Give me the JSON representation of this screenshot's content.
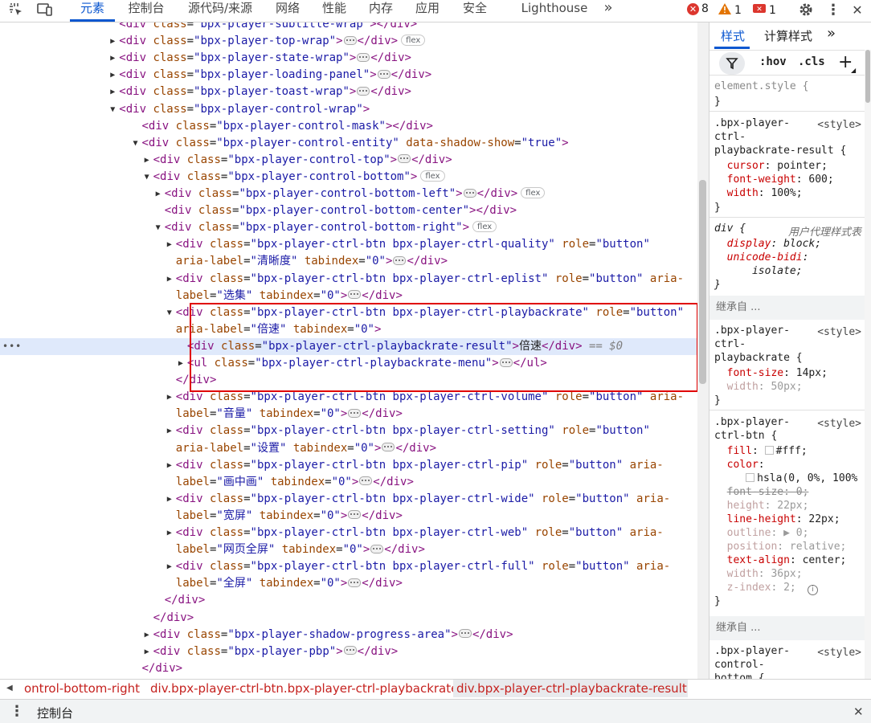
{
  "toolbar": {
    "tabs": [
      "元素",
      "控制台",
      "源代码/来源",
      "网络",
      "性能",
      "内存",
      "应用",
      "安全",
      "Lighthouse"
    ],
    "overflow_glyph": "»",
    "errors": "8",
    "warnings": "1",
    "issues": "1"
  },
  "dom_lines": [
    {
      "indent": 13,
      "tri": "",
      "html": "<span class='tg'>&lt;div</span> <span class='an'>class</span>=<span class='av'>\"bpx-player-subtitle-wrap\"</span><span class='tg'>&gt;&lt;/div&gt;</span>"
    },
    {
      "indent": 13,
      "tri": "▶",
      "html": "<span class='tg'>&lt;div</span> <span class='an'>class</span>=<span class='av'>\"bpx-player-top-wrap\"</span><span class='tg'>&gt;</span><span class='ell'></span><span class='tg'>&lt;/div&gt;</span><span class='flex'>flex</span>"
    },
    {
      "indent": 13,
      "tri": "▶",
      "html": "<span class='tg'>&lt;div</span> <span class='an'>class</span>=<span class='av'>\"bpx-player-state-wrap\"</span><span class='tg'>&gt;</span><span class='ell'></span><span class='tg'>&lt;/div&gt;</span>"
    },
    {
      "indent": 13,
      "tri": "▶",
      "html": "<span class='tg'>&lt;div</span> <span class='an'>class</span>=<span class='av'>\"bpx-player-loading-panel\"</span><span class='tg'>&gt;</span><span class='ell'></span><span class='tg'>&lt;/div&gt;</span>"
    },
    {
      "indent": 13,
      "tri": "▶",
      "html": "<span class='tg'>&lt;div</span> <span class='an'>class</span>=<span class='av'>\"bpx-player-toast-wrap\"</span><span class='tg'>&gt;</span><span class='ell'></span><span class='tg'>&lt;/div&gt;</span>"
    },
    {
      "indent": 13,
      "tri": "▼",
      "html": "<span class='tg'>&lt;div</span> <span class='an'>class</span>=<span class='av'>\"bpx-player-control-wrap\"</span><span class='tg'>&gt;</span>"
    },
    {
      "indent": 15,
      "tri": "",
      "html": "<span class='tg'>&lt;div</span> <span class='an'>class</span>=<span class='av'>\"bpx-player-control-mask\"</span><span class='tg'>&gt;&lt;/div&gt;</span>"
    },
    {
      "indent": 15,
      "tri": "▼",
      "html": "<span class='tg'>&lt;div</span> <span class='an'>class</span>=<span class='av'>\"bpx-player-control-entity\"</span> <span class='an'>data-shadow-show</span>=<span class='av'>\"true\"</span><span class='tg'>&gt;</span>"
    },
    {
      "indent": 16,
      "tri": "▶",
      "html": "<span class='tg'>&lt;div</span> <span class='an'>class</span>=<span class='av'>\"bpx-player-control-top\"</span><span class='tg'>&gt;</span><span class='ell'></span><span class='tg'>&lt;/div&gt;</span>"
    },
    {
      "indent": 16,
      "tri": "▼",
      "html": "<span class='tg'>&lt;div</span> <span class='an'>class</span>=<span class='av'>\"bpx-player-control-bottom\"</span><span class='tg'>&gt;</span><span class='flex'>flex</span>"
    },
    {
      "indent": 17,
      "tri": "▶",
      "html": "<span class='tg'>&lt;div</span> <span class='an'>class</span>=<span class='av'>\"bpx-player-control-bottom-left\"</span><span class='tg'>&gt;</span><span class='ell'></span><span class='tg'>&lt;/div&gt;</span><span class='flex'>flex</span>"
    },
    {
      "indent": 17,
      "tri": "",
      "html": "<span class='tg'>&lt;div</span> <span class='an'>class</span>=<span class='av'>\"bpx-player-control-bottom-center\"</span><span class='tg'>&gt;&lt;/div&gt;</span>"
    },
    {
      "indent": 17,
      "tri": "▼",
      "html": "<span class='tg'>&lt;div</span> <span class='an'>class</span>=<span class='av'>\"bpx-player-control-bottom-right\"</span><span class='tg'>&gt;</span><span class='flex'>flex</span>"
    },
    {
      "indent": 18,
      "tri": "▶",
      "html": "<span class='tg'>&lt;div</span> <span class='an'>class</span>=<span class='av'>\"bpx-player-ctrl-btn bpx-player-ctrl-quality\"</span> <span class='an'>role</span>=<span class='av'>\"button\"</span>"
    },
    {
      "indent": 18,
      "tri": "",
      "html": "<span class='an'>aria-label</span>=<span class='av'>\"清晰度\"</span> <span class='an'>tabindex</span>=<span class='av'>\"0\"</span><span class='tg'>&gt;</span><span class='ell'></span><span class='tg'>&lt;/div&gt;</span>"
    },
    {
      "indent": 18,
      "tri": "▶",
      "html": "<span class='tg'>&lt;div</span> <span class='an'>class</span>=<span class='av'>\"bpx-player-ctrl-btn bpx-player-ctrl-eplist\"</span> <span class='an'>role</span>=<span class='av'>\"button\"</span> <span class='an'>aria-</span>"
    },
    {
      "indent": 18,
      "tri": "",
      "html": "<span class='an'>label</span>=<span class='av'>\"选集\"</span> <span class='an'>tabindex</span>=<span class='av'>\"0\"</span><span class='tg'>&gt;</span><span class='ell'></span><span class='tg'>&lt;/div&gt;</span>"
    },
    {
      "indent": 18,
      "tri": "▼",
      "html": "<span class='tg'>&lt;div</span> <span class='an'>class</span>=<span class='av'>\"bpx-player-ctrl-btn bpx-player-ctrl-playbackrate\"</span> <span class='an'>role</span>=<span class='av'>\"button\"</span>"
    },
    {
      "indent": 18,
      "tri": "",
      "html": "<span class='an'>aria-label</span>=<span class='av'>\"倍速\"</span> <span class='an'>tabindex</span>=<span class='av'>\"0\"</span><span class='tg'>&gt;</span>"
    },
    {
      "indent": 19,
      "tri": "",
      "hl": true,
      "html": "<span class='tg'>&lt;div</span> <span class='an'>class</span>=<span class='av'>\"bpx-player-ctrl-playbackrate-result\"</span><span class='tg'>&gt;</span><span class='tx'>倍速</span><span class='tg'>&lt;/div&gt;</span> <span class='dim'>== $0</span>"
    },
    {
      "indent": 19,
      "tri": "▶",
      "html": "<span class='tg'>&lt;ul</span> <span class='an'>class</span>=<span class='av'>\"bpx-player-ctrl-playbackrate-menu\"</span><span class='tg'>&gt;</span><span class='ell'></span><span class='tg'>&lt;/ul&gt;</span>"
    },
    {
      "indent": 18,
      "tri": "",
      "html": "<span class='tg'>&lt;/div&gt;</span>"
    },
    {
      "indent": 18,
      "tri": "▶",
      "html": "<span class='tg'>&lt;div</span> <span class='an'>class</span>=<span class='av'>\"bpx-player-ctrl-btn bpx-player-ctrl-volume\"</span> <span class='an'>role</span>=<span class='av'>\"button\"</span> <span class='an'>aria-</span>"
    },
    {
      "indent": 18,
      "tri": "",
      "html": "<span class='an'>label</span>=<span class='av'>\"音量\"</span> <span class='an'>tabindex</span>=<span class='av'>\"0\"</span><span class='tg'>&gt;</span><span class='ell'></span><span class='tg'>&lt;/div&gt;</span>"
    },
    {
      "indent": 18,
      "tri": "▶",
      "html": "<span class='tg'>&lt;div</span> <span class='an'>class</span>=<span class='av'>\"bpx-player-ctrl-btn bpx-player-ctrl-setting\"</span> <span class='an'>role</span>=<span class='av'>\"button\"</span>"
    },
    {
      "indent": 18,
      "tri": "",
      "html": "<span class='an'>aria-label</span>=<span class='av'>\"设置\"</span> <span class='an'>tabindex</span>=<span class='av'>\"0\"</span><span class='tg'>&gt;</span><span class='ell'></span><span class='tg'>&lt;/div&gt;</span>"
    },
    {
      "indent": 18,
      "tri": "▶",
      "html": "<span class='tg'>&lt;div</span> <span class='an'>class</span>=<span class='av'>\"bpx-player-ctrl-btn bpx-player-ctrl-pip\"</span> <span class='an'>role</span>=<span class='av'>\"button\"</span> <span class='an'>aria-</span>"
    },
    {
      "indent": 18,
      "tri": "",
      "html": "<span class='an'>label</span>=<span class='av'>\"画中画\"</span> <span class='an'>tabindex</span>=<span class='av'>\"0\"</span><span class='tg'>&gt;</span><span class='ell'></span><span class='tg'>&lt;/div&gt;</span>"
    },
    {
      "indent": 18,
      "tri": "▶",
      "html": "<span class='tg'>&lt;div</span> <span class='an'>class</span>=<span class='av'>\"bpx-player-ctrl-btn bpx-player-ctrl-wide\"</span> <span class='an'>role</span>=<span class='av'>\"button\"</span> <span class='an'>aria-</span>"
    },
    {
      "indent": 18,
      "tri": "",
      "html": "<span class='an'>label</span>=<span class='av'>\"宽屏\"</span> <span class='an'>tabindex</span>=<span class='av'>\"0\"</span><span class='tg'>&gt;</span><span class='ell'></span><span class='tg'>&lt;/div&gt;</span>"
    },
    {
      "indent": 18,
      "tri": "▶",
      "html": "<span class='tg'>&lt;div</span> <span class='an'>class</span>=<span class='av'>\"bpx-player-ctrl-btn bpx-player-ctrl-web\"</span> <span class='an'>role</span>=<span class='av'>\"button\"</span> <span class='an'>aria-</span>"
    },
    {
      "indent": 18,
      "tri": "",
      "html": "<span class='an'>label</span>=<span class='av'>\"网页全屏\"</span> <span class='an'>tabindex</span>=<span class='av'>\"0\"</span><span class='tg'>&gt;</span><span class='ell'></span><span class='tg'>&lt;/div&gt;</span>"
    },
    {
      "indent": 18,
      "tri": "▶",
      "html": "<span class='tg'>&lt;div</span> <span class='an'>class</span>=<span class='av'>\"bpx-player-ctrl-btn bpx-player-ctrl-full\"</span> <span class='an'>role</span>=<span class='av'>\"button\"</span> <span class='an'>aria-</span>"
    },
    {
      "indent": 18,
      "tri": "",
      "html": "<span class='an'>label</span>=<span class='av'>\"全屏\"</span> <span class='an'>tabindex</span>=<span class='av'>\"0\"</span><span class='tg'>&gt;</span><span class='ell'></span><span class='tg'>&lt;/div&gt;</span>"
    },
    {
      "indent": 17,
      "tri": "",
      "html": "<span class='tg'>&lt;/div&gt;</span>"
    },
    {
      "indent": 16,
      "tri": "",
      "html": "<span class='tg'>&lt;/div&gt;</span>"
    },
    {
      "indent": 16,
      "tri": "▶",
      "html": "<span class='tg'>&lt;div</span> <span class='an'>class</span>=<span class='av'>\"bpx-player-shadow-progress-area\"</span><span class='tg'>&gt;</span><span class='ell'></span><span class='tg'>&lt;/div&gt;</span>"
    },
    {
      "indent": 16,
      "tri": "▶",
      "html": "<span class='tg'>&lt;div</span> <span class='an'>class</span>=<span class='av'>\"bpx-player-pbp\"</span><span class='tg'>&gt;</span><span class='ell'></span><span class='tg'>&lt;/div&gt;</span>"
    },
    {
      "indent": 15,
      "tri": "",
      "html": "<span class='tg'>&lt;/div&gt;</span>"
    }
  ],
  "styles": {
    "tabs": [
      "样式",
      "计算样式"
    ],
    "filter_hov": ":hov",
    "filter_cls": ".cls",
    "element_style": "element.style {",
    "close_brace": "}",
    "inherited_label": "继承自 ...",
    "src_label": "<style>",
    "ua_label": "用户代理样式表"
  },
  "breadcrumbs": [
    "ontrol-bottom-right",
    "div.bpx-player-ctrl-btn.bpx-player-ctrl-playbackrate",
    "div.bpx-player-ctrl-playbackrate-result"
  ],
  "drawer": {
    "label": "控制台"
  }
}
